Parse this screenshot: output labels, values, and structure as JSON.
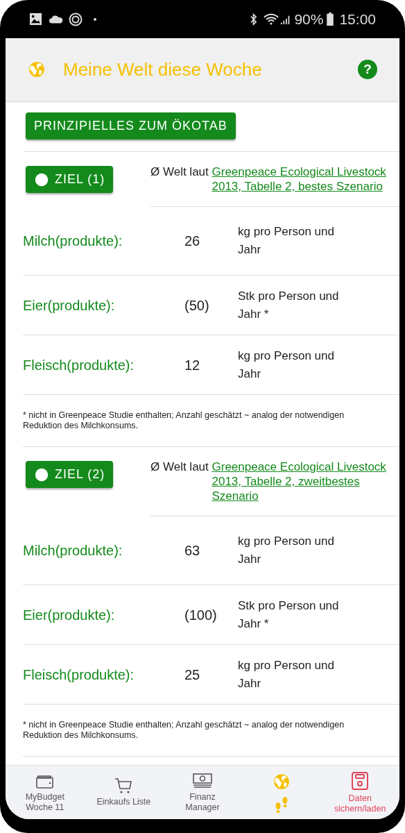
{
  "status_bar": {
    "battery": "90%",
    "time": "15:00"
  },
  "app_bar": {
    "title": "Meine Welt diese Woche",
    "help": "?"
  },
  "intro_button": "PRINZIPIELLES ZUM ÖKOTAB",
  "goals": [
    {
      "button": "ZIEL (1)",
      "source_prefix": "Ø Welt laut ",
      "source_link": "Greenpeace Ecological Livestock 2013, Tabelle 2, bestes Szenario",
      "rows": [
        {
          "label": "Milch(produkte):",
          "value": "26",
          "unit": "kg pro Person und Jahr"
        },
        {
          "label": "Eier(produkte):",
          "value": "(50)",
          "unit": "Stk pro Person und Jahr *"
        },
        {
          "label": "Fleisch(produkte):",
          "value": "12",
          "unit": "kg pro Person und Jahr"
        }
      ],
      "footnote": "* nicht in Greenpeace Studie enthalten; Anzahl geschätzt ~ analog der notwendigen Reduktion des Milchkonsums."
    },
    {
      "button": "ZIEL (2)",
      "source_prefix": "Ø Welt laut ",
      "source_link": "Greenpeace Ecological Livestock 2013, Tabelle 2, zweitbestes Szenario",
      "rows": [
        {
          "label": "Milch(produkte):",
          "value": "63",
          "unit": "kg pro Person und Jahr"
        },
        {
          "label": "Eier(produkte):",
          "value": "(100)",
          "unit": "Stk pro Person und Jahr *"
        },
        {
          "label": "Fleisch(produkte):",
          "value": "25",
          "unit": "kg pro Person und Jahr"
        }
      ],
      "footnote": "* nicht in Greenpeace Studie enthalten; Anzahl geschätzt ~ analog der notwendigen Reduktion des Milchkonsums."
    }
  ],
  "bottom_nav": [
    {
      "kind": "wallet",
      "label": "MyBudget Woche 11",
      "color": "#555555"
    },
    {
      "kind": "cart",
      "label": "Einkaufs Liste",
      "color": "#555555"
    },
    {
      "kind": "money",
      "label": "Finanz Manager",
      "color": "#555555"
    },
    {
      "kind": "world",
      "color": "#f5c000"
    },
    {
      "kind": "save",
      "label": "Daten sichern/laden",
      "color": "#e0455a"
    }
  ]
}
